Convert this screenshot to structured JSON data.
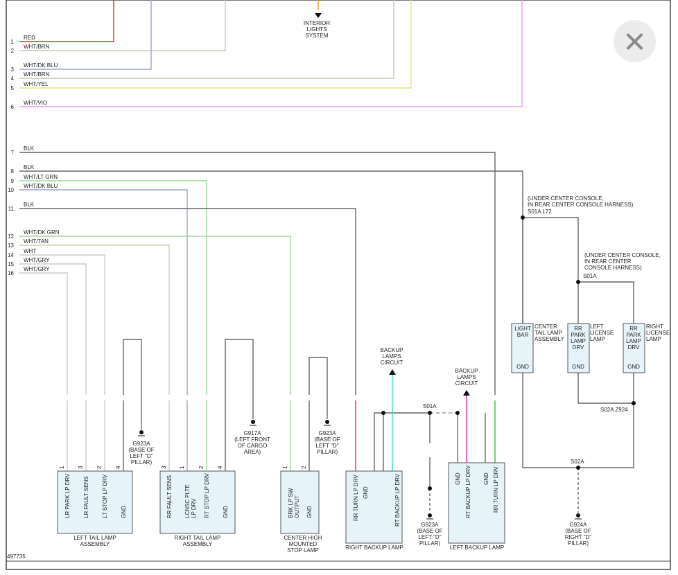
{
  "diagram_id": "497735",
  "top_label": "INTERIOR LIGHTS SYSTEM",
  "close_icon": "close-icon",
  "connector_rows": [
    {
      "pin": "1",
      "wire": "RED",
      "color": "#e53030"
    },
    {
      "pin": "2",
      "wire": "WHT/BRN",
      "color": "#c9c7b2"
    },
    {
      "pin": "3",
      "wire": "WHT/DK BLU",
      "color": "#9aa4cf"
    },
    {
      "pin": "4",
      "wire": "WHT/BRN",
      "color": "#c9c7b2"
    },
    {
      "pin": "5",
      "wire": "WHT/YEL",
      "color": "#e6e08a"
    },
    {
      "pin": "6",
      "wire": "WHT/VIO",
      "color": "#e3a0e8"
    },
    {
      "pin": "7",
      "wire": "BLK",
      "color": "#666666"
    },
    {
      "pin": "8",
      "wire": "BLK",
      "color": "#666666"
    },
    {
      "pin": "9",
      "wire": "WHT/LT GRN",
      "color": "#9edb9e"
    },
    {
      "pin": "10",
      "wire": "WHT/DK BLU",
      "color": "#9aa4cf"
    },
    {
      "pin": "11",
      "wire": "BLK",
      "color": "#666666"
    },
    {
      "pin": "12",
      "wire": "WHT/DK GRN",
      "color": "#a9d49e"
    },
    {
      "pin": "13",
      "wire": "WHT/TAN",
      "color": "#cfcbb0"
    },
    {
      "pin": "14",
      "wire": "WHT",
      "color": "#cccccc"
    },
    {
      "pin": "15",
      "wire": "WHT/GRY",
      "color": "#cccccc"
    },
    {
      "pin": "16",
      "wire": "WHT/GRY",
      "color": "#cccccc"
    }
  ],
  "components": {
    "left_tail": {
      "title": "LEFT TAIL LAMP\nASSEMBLY",
      "pins": [
        "LR PARK LP DRV",
        "LR FAULT SENS",
        "LT STOP LP DRV",
        "GND"
      ],
      "pin_nums": [
        "1",
        "3",
        "2",
        "4"
      ]
    },
    "right_tail": {
      "title": "RIGHT TAIL LAMP\nASSEMBLY",
      "pins": [
        "RR FAULT SENS",
        "LCNSC PLTE\nLP DRV",
        "RT STOP LP DRV",
        "GND"
      ],
      "pin_nums": [
        "3",
        "1",
        "2",
        "4"
      ]
    },
    "chmsl": {
      "title": "CENTER HIGH\nMOUNTED\nSTOP LAMP",
      "pins": [
        "BRK LP SW\nOUTPUT",
        "GND"
      ],
      "pin_nums": [
        "1",
        "2"
      ]
    },
    "right_backup": {
      "title": "RIGHT BACKUP LAMP",
      "pins": [
        "RR TURN LP DRV",
        "GND",
        "RT BACKUP LP DRV"
      ],
      "pin_nums": [
        "2",
        "1",
        "2",
        "1"
      ]
    },
    "left_backup": {
      "title": "LEFT BACKUP LAMP",
      "pins": [
        "GND",
        "RT BACKUP LP DRV",
        "GND",
        "RR TURN LP DRV"
      ],
      "pin_nums": [
        "1",
        "2",
        "1",
        "2"
      ]
    },
    "light_bar": {
      "title": "CENTER\nTAIL LAMP\nASSEMBLY",
      "label": "LIGHT\nBAR",
      "gnd": "GND"
    },
    "rr_park_left": {
      "title": "LEFT\nLICENSE\nLAMP",
      "label": "RR\nPARK\nLAMP\nDRV",
      "gnd": "GND"
    },
    "rr_park_right": {
      "title": "RIGHT\nLICENSE\nLAMP",
      "label": "RR\nPARK\nLAMP\nDRV",
      "gnd": "GND"
    }
  },
  "grounds": {
    "g923a_left": "G923A\n(BASE OF\nLEFT \"D\"\nPILLAR)",
    "g917a": "G917A\n(LEFT FRONT\nOF CARGO\nAREA)",
    "g923a_center": "G923A\n(BASE OF\nLEFT \"D\"\nPILLAR)",
    "g923a_backup": "G923A\n(BASE OF\nLEFT \"D\"\nPILLAR)",
    "g924a": "G924A\n(BASE OF\nRIGHT \"D\"\nPILLAR)"
  },
  "notes": {
    "console_1": "(UNDER CENTER CONSOLE,\nIN REAR CENTER CONSOLE HARNESS)",
    "s01a_l72": "S01A L72",
    "console_2": "(UNDER CENTER CONSOLE,\nIN REAR CENTER\nCONSOLE HARNESS)",
    "s01a": "S01A",
    "s01a_mid": "S01A",
    "s02a_z924": "S02A Z924",
    "s02a": "S02A",
    "backup_circuit_1": "BACKUP\nLAMPS\nCIRCUIT",
    "backup_circuit_2": "BACKUP\nLAMPS\nCIRCUIT"
  }
}
